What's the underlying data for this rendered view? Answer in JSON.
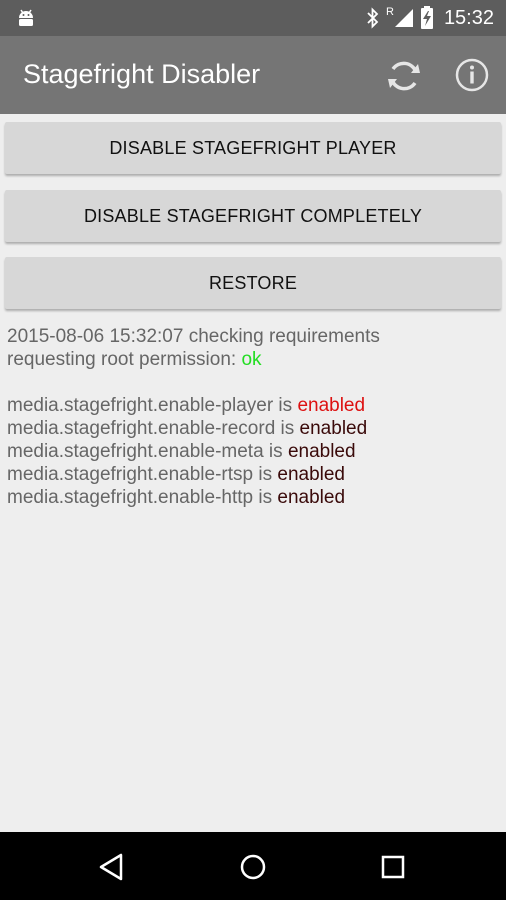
{
  "status_bar": {
    "time": "15:32",
    "roaming_indicator": "R",
    "icons": [
      "android-notification-icon",
      "bluetooth-icon",
      "signal-icon",
      "battery-charging-icon"
    ]
  },
  "app_bar": {
    "title": "Stagefright Disabler",
    "actions": [
      "refresh-icon",
      "info-icon"
    ]
  },
  "buttons": {
    "disable_player": "DISABLE STAGEFRIGHT PLAYER",
    "disable_completely": "DISABLE STAGEFRIGHT COMPLETELY",
    "restore": "RESTORE"
  },
  "log": {
    "line1": "2015-08-06 15:32:07 checking requirements",
    "line2_prefix": "requesting root permission: ",
    "line2_status": "ok",
    "props": [
      {
        "text": "media.stagefright.enable-player is ",
        "status": "enabled",
        "status_color": "#dd1111"
      },
      {
        "text": "media.stagefright.enable-record is ",
        "status": "enabled",
        "status_color": "#3a0a0a"
      },
      {
        "text": "media.stagefright.enable-meta is ",
        "status": "enabled",
        "status_color": "#3a0a0a"
      },
      {
        "text": "media.stagefright.enable-rtsp is ",
        "status": "enabled",
        "status_color": "#3a0a0a"
      },
      {
        "text": "media.stagefright.enable-http is ",
        "status": "enabled",
        "status_color": "#3a0a0a"
      }
    ]
  },
  "nav_bar": {
    "icons": [
      "back-icon",
      "home-icon",
      "recents-icon"
    ]
  },
  "colors": {
    "status_bar": "#5d5d5d",
    "app_bar": "#757575",
    "background": "#eeeeee",
    "button": "#d7d7d7",
    "ok_green": "#22dd22"
  }
}
